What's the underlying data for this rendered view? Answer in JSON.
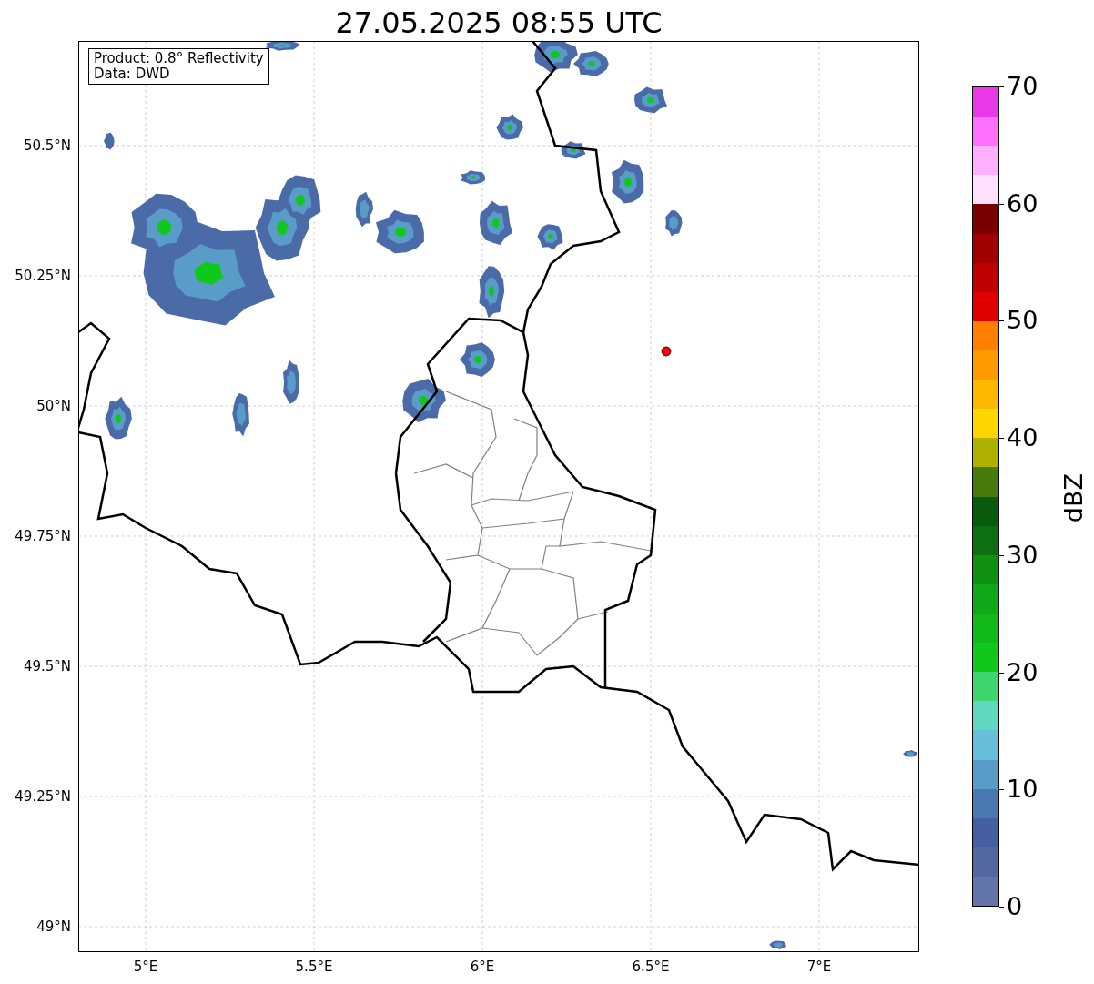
{
  "figure": {
    "title": "27.05.2025 08:55 UTC",
    "legend": [
      "Product: 0.8° Reflectivity",
      "Data: DWD"
    ],
    "map": {
      "xticks": [
        "5°E",
        "5.5°E",
        "6°E",
        "6.5°E",
        "7°E"
      ],
      "yticks": [
        "50.5°N",
        "50.25°N",
        "50°N",
        "49.75°N",
        "49.5°N",
        "49.25°N",
        "49°N"
      ]
    },
    "colorbar": {
      "label": "dBZ",
      "ticks": [
        "70",
        "60",
        "50",
        "40",
        "30",
        "20",
        "10",
        "0"
      ],
      "segments": [
        {
          "color": "#e838e8"
        },
        {
          "color": "#ff70ff"
        },
        {
          "color": "#ffb0ff"
        },
        {
          "color": "#ffe0ff"
        },
        {
          "color": "#780000"
        },
        {
          "color": "#a00000"
        },
        {
          "color": "#c00000"
        },
        {
          "color": "#e00000"
        },
        {
          "color": "#ff7f00"
        },
        {
          "color": "#ff9b00"
        },
        {
          "color": "#ffb800"
        },
        {
          "color": "#ffd700"
        },
        {
          "color": "#b0b000"
        },
        {
          "color": "#487a0c"
        },
        {
          "color": "#085a0c"
        },
        {
          "color": "#0c7010"
        },
        {
          "color": "#0e9010"
        },
        {
          "color": "#10a818"
        },
        {
          "color": "#10b818"
        },
        {
          "color": "#10c81a"
        },
        {
          "color": "#3dd66e"
        },
        {
          "color": "#60d8c0"
        },
        {
          "color": "#66c0dc"
        },
        {
          "color": "#5a9cc8"
        },
        {
          "color": "#4a78b0"
        },
        {
          "color": "#4460a3"
        },
        {
          "color": "#5468a0"
        },
        {
          "color": "#6374a8"
        }
      ]
    }
  }
}
